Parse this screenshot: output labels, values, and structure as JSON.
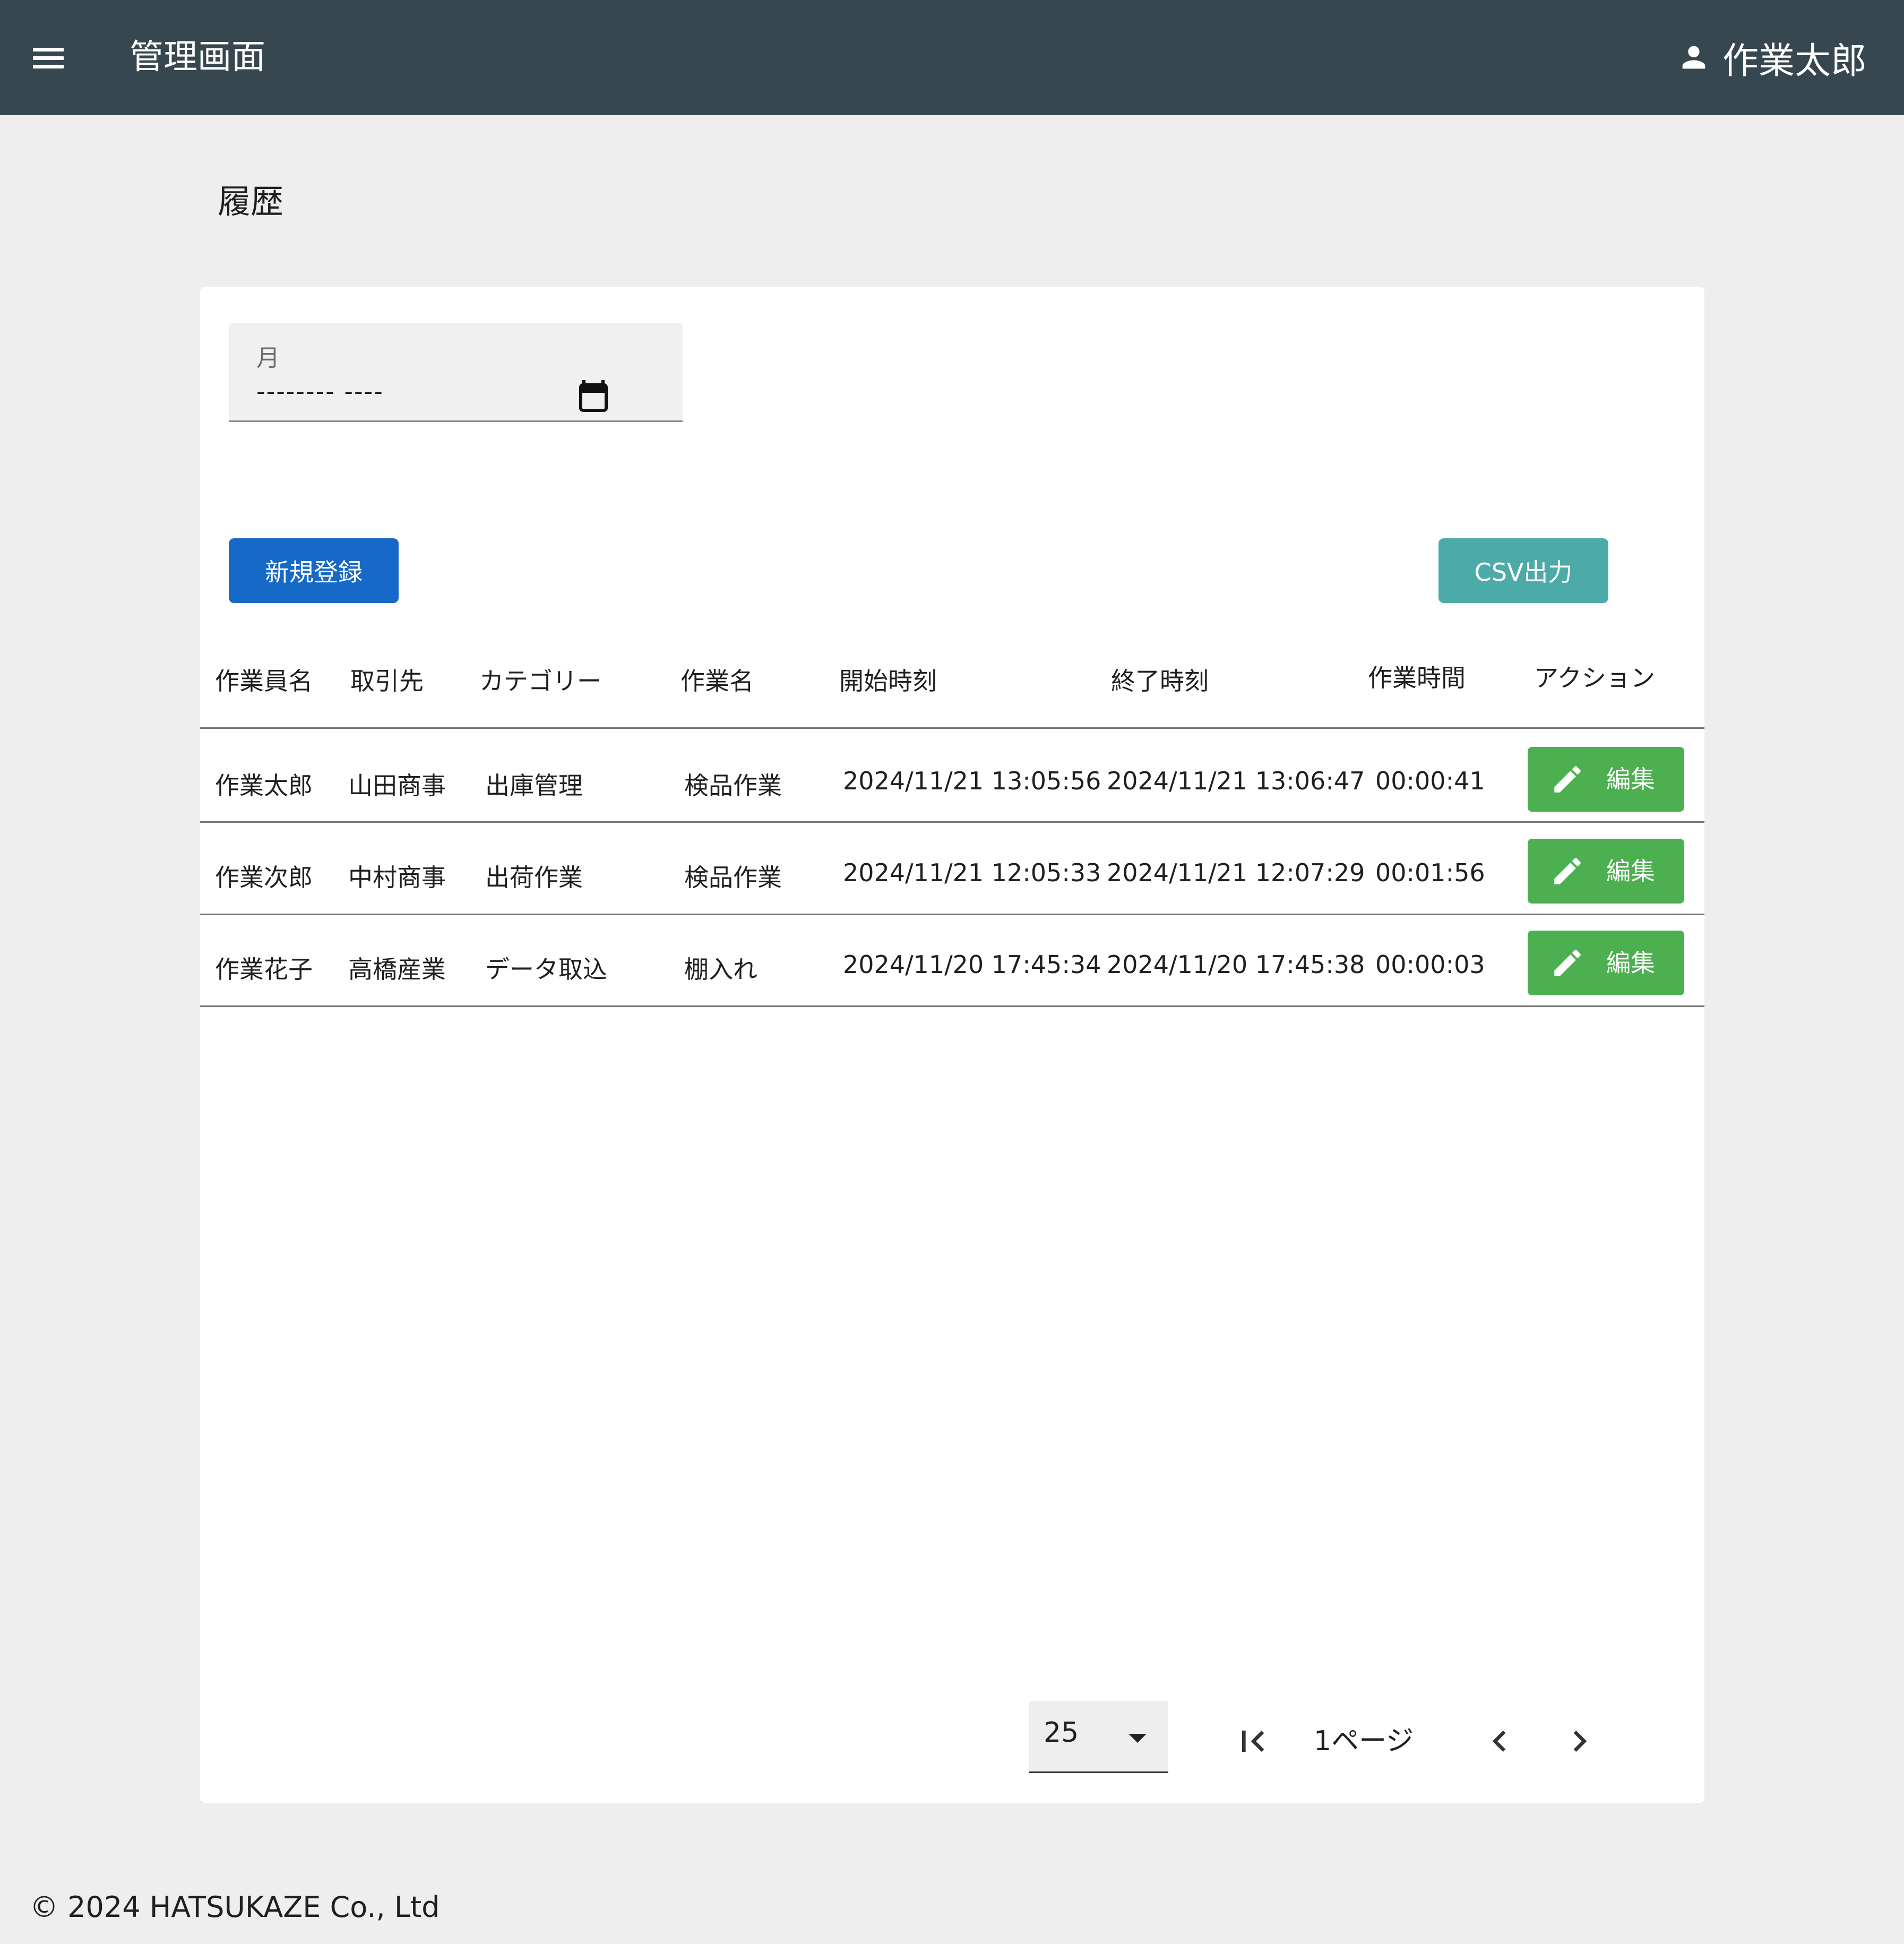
{
  "header": {
    "title": "管理画面",
    "user_name": "作業太郎"
  },
  "page": {
    "title": "履歴"
  },
  "filter": {
    "month_label": "月",
    "month_value": "-------- ----"
  },
  "actions": {
    "new_label": "新規登録",
    "csv_label": "CSV出力"
  },
  "table": {
    "columns": [
      "作業員名",
      "取引先",
      "カテゴリー",
      "作業名",
      "開始時刻",
      "終了時刻",
      "作業時間",
      "アクション"
    ],
    "rows": [
      {
        "worker": "作業太郎",
        "client": "山田商事",
        "category": "出庫管理",
        "task": "検品作業",
        "start": "2024/11/21 13:05:56",
        "end": "2024/11/21 13:06:47",
        "duration": "00:00:41",
        "action": "編集"
      },
      {
        "worker": "作業次郎",
        "client": "中村商事",
        "category": "出荷作業",
        "task": "検品作業",
        "start": "2024/11/21 12:05:33",
        "end": "2024/11/21 12:07:29",
        "duration": "00:01:56",
        "action": "編集"
      },
      {
        "worker": "作業花子",
        "client": "高橋産業",
        "category": "データ取込",
        "task": "棚入れ",
        "start": "2024/11/20 17:45:34",
        "end": "2024/11/20 17:45:38",
        "duration": "00:00:03",
        "action": "編集"
      }
    ]
  },
  "pagination": {
    "rows_per_page": "25",
    "page_label": "1ページ"
  },
  "footer": {
    "copyright": "© 2024 HATSUKAZE Co., Ltd"
  },
  "colors": {
    "appbar": "#37474f",
    "primary": "#1769c7",
    "csv": "#4caba8",
    "edit": "#4caf50",
    "background": "#eeeeee"
  }
}
